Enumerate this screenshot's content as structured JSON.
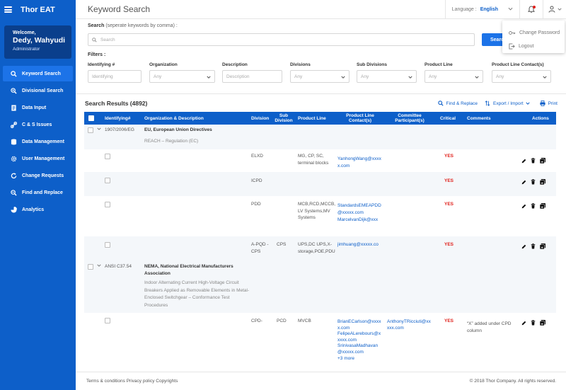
{
  "app": {
    "brand": "Thor EAT"
  },
  "user": {
    "welcome": "Welcome,",
    "name": "Dedy, Wahyudi",
    "role": "Administrator"
  },
  "sidebar": {
    "items": [
      {
        "label": "Keyword Search",
        "icon": "search-icon",
        "active": true
      },
      {
        "label": "Divisional Search",
        "icon": "zoom-icon"
      },
      {
        "label": "Data Input",
        "icon": "document-icon"
      },
      {
        "label": "C & S Issues",
        "icon": "link-icon"
      },
      {
        "label": "Data Management",
        "icon": "database-icon"
      },
      {
        "label": "User Management",
        "icon": "gear-icon"
      },
      {
        "label": "Change Requests",
        "icon": "refresh-icon"
      },
      {
        "label": "Find and Replace",
        "icon": "find-replace-icon"
      },
      {
        "label": "Analytics",
        "icon": "chart-icon"
      }
    ]
  },
  "header": {
    "title": "Keyword Search",
    "language_label": "Language :",
    "language_value": "English"
  },
  "user_menu": {
    "change_password": "Change Password",
    "logout": "Logout"
  },
  "search": {
    "label": "Search",
    "hint": "(seperate keywords by comma) :",
    "placeholder": "Search",
    "button": "Search"
  },
  "filters": {
    "label": "Filters :",
    "items": [
      {
        "label": "Identifying #",
        "placeholder": "Identifying"
      },
      {
        "label": "Organization",
        "placeholder": "Any"
      },
      {
        "label": "Description",
        "placeholder": "Description"
      },
      {
        "label": "Divisions",
        "placeholder": "Any"
      },
      {
        "label": "Sub Divisions",
        "placeholder": "Any"
      },
      {
        "label": "Product Line",
        "placeholder": "Any"
      },
      {
        "label": "Product Line Contact(s)",
        "placeholder": "Any"
      }
    ]
  },
  "results": {
    "title": "Search Results (4892)",
    "find_replace": "Find & Replace",
    "export_import": "Export / Import",
    "print": "Print"
  },
  "table": {
    "headers": {
      "identifying": "Identifying#",
      "org_desc": "Organization & Description",
      "division": "Division",
      "sub_division": "Sub Division",
      "product_line": "Product Line",
      "pl_contacts": "Product Line Contact(s)",
      "committee": "Committee Participant(s)",
      "critical": "Critical",
      "comments": "Comments",
      "actions": "Actions"
    },
    "groups": [
      {
        "id": "1907/2006/EG",
        "org": "EU, European Union Directives",
        "desc": "REACH – Regulation (EC)",
        "rows": [
          {
            "division": "ELXD",
            "product_line": "MG, CP, SC, terminal blocks",
            "contacts": "YanhongWang@xxxxx.com",
            "critical": "YES"
          },
          {
            "division": "ICPD",
            "critical": "YES"
          },
          {
            "division": "PDD",
            "product_line": "MCB,RCD,MCCB, LV Systems,MV Systems",
            "contacts": "StandardsEMEAPDD@xxxxx.com",
            "contacts2": "MarcelvanDijk@xxx",
            "critical": "YES"
          },
          {
            "division": "A-PQD -CPS",
            "sub_division": "CPS",
            "product_line": "UPS,DC UPS,X-storage,POE,PDU",
            "contacts": "jimhuang@xxxxx.co",
            "critical": "YES"
          }
        ]
      },
      {
        "id": "ANSI C37.54",
        "org": "NEMA, National Electrical Manufacturers Association",
        "desc": "Indoor Alternating Current High-Voltage Circuit Breakers Applied as Removable Elements in Metal-Enclosed Switchgear – Conformance Test Procedures",
        "rows": [
          {
            "division": "CPD-",
            "sub_division": "PCD",
            "product_line": "MVCB",
            "contacts": "BrianECarlson@xxxxx.com",
            "contacts2": "FelipeALerebours@xxxxx.com",
            "contacts3": "SrinivasaMadhavan@xxxxx.com",
            "more": "+3 more",
            "committee": "AnthonyTRicciuti@xxxxx.com",
            "critical": "YES",
            "comment": "“X” added under CPD column"
          }
        ]
      }
    ]
  },
  "footer": {
    "links": "Terms & conditions Privacy policy Copyrights",
    "copyright": "© 2018 Thor Company. All rights reserved."
  },
  "colors": {
    "primary": "#0d5fc9",
    "sidebar_card": "#0a3f8c",
    "danger": "#e0201b"
  }
}
